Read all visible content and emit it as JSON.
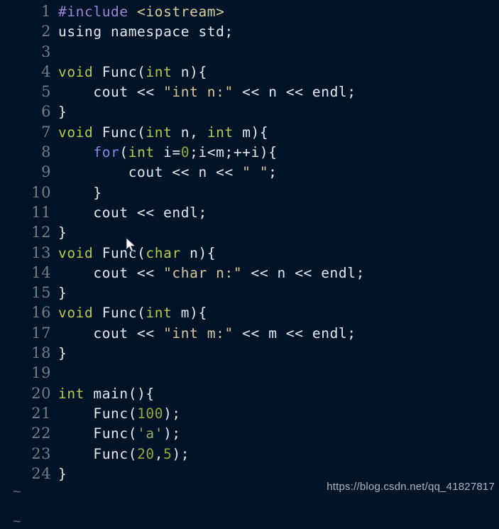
{
  "editor": {
    "background_color": "#001327",
    "gutter_color": "#6f7f85",
    "default_text_color": "#e3e8f2",
    "filler_symbol": "~",
    "watermark": "https://blog.csdn.net/qq_41827817"
  },
  "palette": {
    "preprocessor": "#9a86d6",
    "header": "#d9cf9c",
    "keyword": "#b7c94e",
    "control": "#7d8ee8",
    "string": "#d9c79a",
    "number": "#96a83c",
    "char": "#8fae6a",
    "plain": "#e3e8f2"
  },
  "code": {
    "language": "cpp",
    "lines": [
      {
        "number": "1",
        "text": "#include <iostream>"
      },
      {
        "number": "2",
        "text": "using namespace std;"
      },
      {
        "number": "3",
        "text": ""
      },
      {
        "number": "4",
        "text": "void Func(int n){"
      },
      {
        "number": "5",
        "text": "    cout << \"int n:\" << n << endl;"
      },
      {
        "number": "6",
        "text": "}"
      },
      {
        "number": "7",
        "text": "void Func(int n, int m){"
      },
      {
        "number": "8",
        "text": "    for(int i=0;i<m;++i){"
      },
      {
        "number": "9",
        "text": "        cout << n << \" \";"
      },
      {
        "number": "10",
        "text": "    }"
      },
      {
        "number": "11",
        "text": "    cout << endl;"
      },
      {
        "number": "12",
        "text": "}"
      },
      {
        "number": "13",
        "text": "void Func(char n){"
      },
      {
        "number": "14",
        "text": "    cout << \"char n:\" << n << endl;"
      },
      {
        "number": "15",
        "text": "}"
      },
      {
        "number": "16",
        "text": "void Func(int m){"
      },
      {
        "number": "17",
        "text": "    cout << \"int m:\" << m << endl;"
      },
      {
        "number": "18",
        "text": "}"
      },
      {
        "number": "19",
        "text": ""
      },
      {
        "number": "20",
        "text": "int main(){"
      },
      {
        "number": "21",
        "text": "    Func(100);"
      },
      {
        "number": "22",
        "text": "    Func('a');"
      },
      {
        "number": "23",
        "text": "    Func(20,5);"
      },
      {
        "number": "24",
        "text": "}"
      }
    ],
    "tilde_rows": [
      "~",
      "~"
    ]
  }
}
